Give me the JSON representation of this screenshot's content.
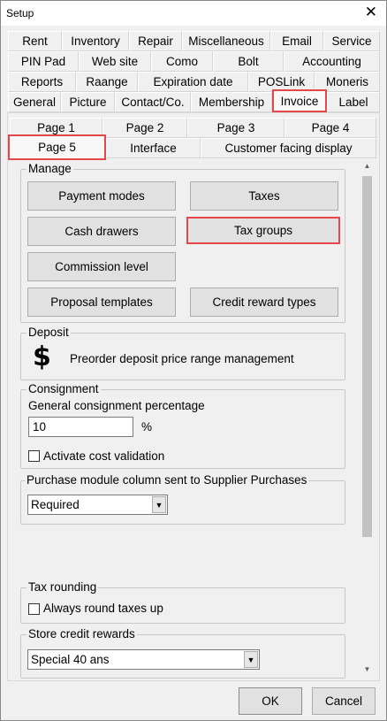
{
  "window": {
    "title": "Setup",
    "close_glyph": "✕"
  },
  "tabs": {
    "row1": [
      "Rent",
      "Inventory",
      "Repair",
      "Miscellaneous",
      "Email",
      "Service"
    ],
    "row2": [
      "PIN Pad",
      "Web site",
      "Como",
      "Bolt",
      "Accounting"
    ],
    "row3": [
      "Reports",
      "Raange",
      "Expiration date",
      "POSLink",
      "Moneris"
    ],
    "row4": [
      "General",
      "Picture",
      "Contact/Co.",
      "Membership",
      "Invoice",
      "Label"
    ],
    "selected": "Invoice"
  },
  "subtabs": {
    "row1": [
      "Page 1",
      "Page 2",
      "Page 3",
      "Page 4"
    ],
    "row2": [
      "Page 5",
      "Interface",
      "Customer facing display"
    ],
    "selected": "Page 5"
  },
  "manage": {
    "legend": "Manage",
    "buttons": [
      "Payment modes",
      "Taxes",
      "Cash drawers",
      "Tax groups",
      "Commission level",
      "Proposal templates",
      "Credit reward types"
    ]
  },
  "deposit": {
    "legend": "Deposit",
    "icon_glyph": "$",
    "icon": "dollar-icon",
    "text": "Preorder deposit price range management"
  },
  "consignment": {
    "legend": "Consignment",
    "percentage_label": "General consignment percentage",
    "percentage_value": "10",
    "percent_sign": "%",
    "checkbox_label": "Activate cost validation",
    "checked": false
  },
  "purchase": {
    "legend": "Purchase module column sent to Supplier Purchases",
    "selected": "Required"
  },
  "tax_rounding": {
    "legend": "Tax rounding",
    "checkbox_label": "Always round taxes up",
    "checked": false
  },
  "store_credit": {
    "legend": "Store credit rewards",
    "selected": "Special 40 ans"
  },
  "footer": {
    "ok": "OK",
    "cancel": "Cancel"
  },
  "colors": {
    "highlight": "#e5474b",
    "window_bg": "#f0f0f0",
    "button_bg": "#e1e1e1"
  }
}
